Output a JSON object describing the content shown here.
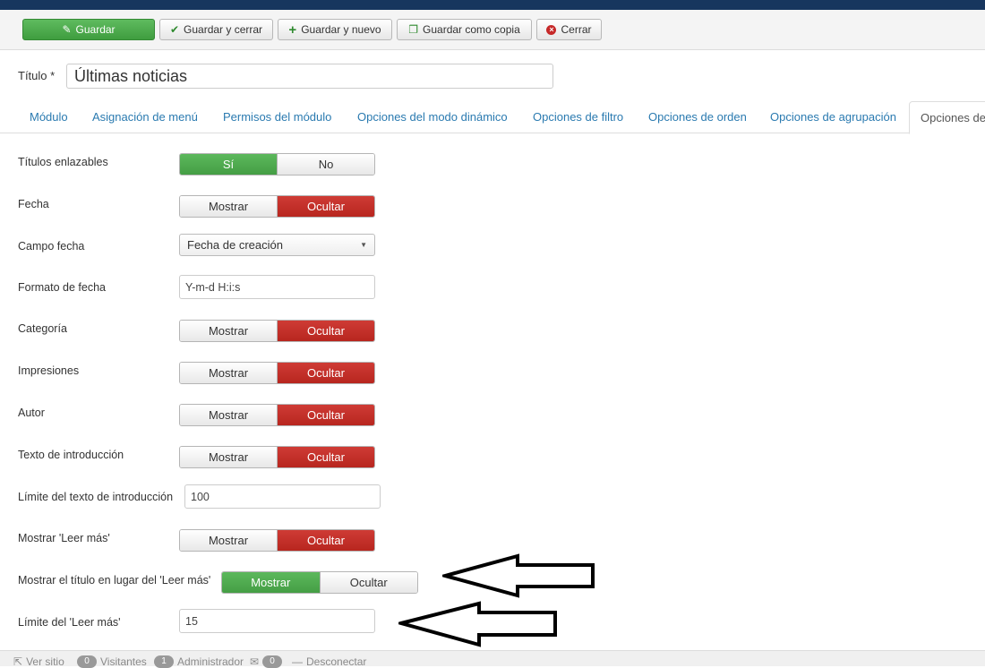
{
  "toolbar": {
    "save": "Guardar",
    "save_close": "Guardar y cerrar",
    "save_new": "Guardar y nuevo",
    "save_copy": "Guardar como copia",
    "close": "Cerrar"
  },
  "title_field": {
    "label": "Título *",
    "value": "Últimas noticias"
  },
  "tabs": [
    "Módulo",
    "Asignación de menú",
    "Permisos del módulo",
    "Opciones del modo dinámico",
    "Opciones de filtro",
    "Opciones de orden",
    "Opciones de agrupación",
    "Opciones de"
  ],
  "rows": {
    "linked_titles": {
      "label": "Títulos enlazables",
      "options": [
        "Sí",
        "No"
      ],
      "selected": "Sí"
    },
    "date": {
      "label": "Fecha",
      "options": [
        "Mostrar",
        "Ocultar"
      ],
      "selected": "Ocultar"
    },
    "date_field": {
      "label": "Campo fecha",
      "value": "Fecha de creación"
    },
    "date_format": {
      "label": "Formato de fecha",
      "value": "Y-m-d H:i:s"
    },
    "category": {
      "label": "Categoría",
      "options": [
        "Mostrar",
        "Ocultar"
      ],
      "selected": "Ocultar"
    },
    "hits": {
      "label": "Impresiones",
      "options": [
        "Mostrar",
        "Ocultar"
      ],
      "selected": "Ocultar"
    },
    "author": {
      "label": "Autor",
      "options": [
        "Mostrar",
        "Ocultar"
      ],
      "selected": "Ocultar"
    },
    "intro_text": {
      "label": "Texto de introducción",
      "options": [
        "Mostrar",
        "Ocultar"
      ],
      "selected": "Ocultar"
    },
    "intro_limit": {
      "label": "Límite del texto de introducción",
      "value": "100"
    },
    "readmore": {
      "label": "Mostrar 'Leer más'",
      "options": [
        "Mostrar",
        "Ocultar"
      ],
      "selected": "Ocultar"
    },
    "readmore_title": {
      "label": "Mostrar el título en lugar del 'Leer más'",
      "options": [
        "Mostrar",
        "Ocultar"
      ],
      "selected": "Mostrar"
    },
    "readmore_limit": {
      "label": "Límite del 'Leer más'",
      "value": "15"
    }
  },
  "statusbar": {
    "view_site": "Ver sitio",
    "visitors_count": "0",
    "visitors": "Visitantes",
    "admin_count": "1",
    "admin": "Administrador",
    "messages_count": "0",
    "logout": "Desconectar"
  },
  "colors": {
    "green": "#46a546",
    "red": "#bd362f",
    "link": "#2a7ab0",
    "topbar": "#17365e"
  }
}
